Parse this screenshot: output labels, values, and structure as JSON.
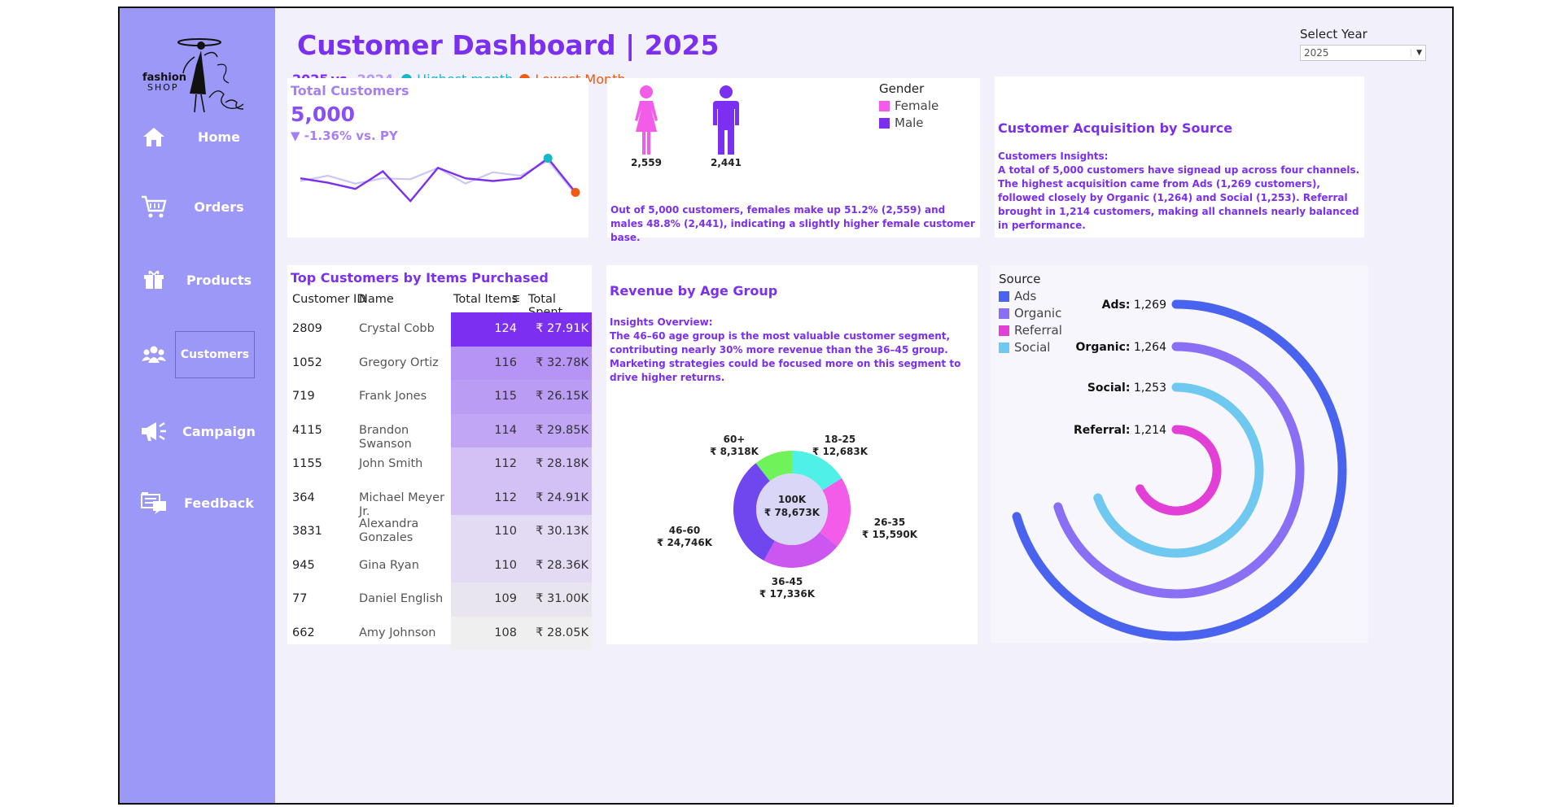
{
  "brand": {
    "line1": "fashion",
    "line2": "SHOP"
  },
  "sidebar": {
    "items": [
      {
        "label": "Home"
      },
      {
        "label": "Orders"
      },
      {
        "label": "Products"
      },
      {
        "label": "Customers"
      },
      {
        "label": "Campaign"
      },
      {
        "label": "Feedback"
      }
    ],
    "active": "Customers"
  },
  "header": {
    "title": "Customer Dashboard | 2025",
    "current_year": "2025",
    "vs": "vs.",
    "prior_year": "2024",
    "highest_label": "Highest month",
    "lowest_label": "Lowest Month"
  },
  "year_select": {
    "label": "Select Year",
    "value": "2025"
  },
  "kpi": {
    "label": "Total Customers",
    "value": "5,000",
    "change": "▼ -1.36% vs. PY",
    "trend_current": [
      36,
      31,
      24,
      44,
      10,
      48,
      36,
      33,
      36,
      59,
      20
    ],
    "trend_prior": [
      33,
      39,
      30,
      36,
      35,
      48,
      30,
      43,
      39,
      56,
      18
    ]
  },
  "gender": {
    "legend_title": "Gender",
    "female_label": "Female",
    "male_label": "Male",
    "female_count": "2,559",
    "male_count": "2,441",
    "insight": "Out of 5,000 customers, females make up 51.2% (2,559) and males 48.8% (2,441), indicating a slightly higher female customer base.",
    "colors": {
      "female": "#f25ce8",
      "male": "#7b2ff0"
    }
  },
  "acquisition": {
    "title": "Customer Acquisition by Source",
    "insight_heading": "Customers Insights:",
    "insight_body": "A total of 5,000 customers have signead up across four channels. The highest acquisition came from Ads (1,269 customers), followed closely by Organic (1,264) and Social (1,253). Referral brought in 1,214 customers, making all channels nearly balanced in performance."
  },
  "top_customers": {
    "title": "Top Customers by Items Purchased",
    "columns": [
      "Customer ID",
      "Name",
      "Total Items",
      "Total Spent"
    ],
    "rows": [
      {
        "id": "2809",
        "name": "Crystal Cobb",
        "items": "124",
        "spent": "₹ 27.91K",
        "shade": "#7b2ff0"
      },
      {
        "id": "1052",
        "name": "Gregory Ortiz",
        "items": "116",
        "spent": "₹ 32.78K",
        "shade": "#b694f5"
      },
      {
        "id": "719",
        "name": "Frank Jones",
        "items": "115",
        "spent": "₹ 26.15K",
        "shade": "#bb9cf5"
      },
      {
        "id": "4115",
        "name": "Brandon Swanson",
        "items": "114",
        "spent": "₹ 29.85K",
        "shade": "#c1a6f5"
      },
      {
        "id": "1155",
        "name": "John Smith",
        "items": "112",
        "spent": "₹ 28.18K",
        "shade": "#d3c1f5"
      },
      {
        "id": "364",
        "name": "Michael Meyer Jr.",
        "items": "112",
        "spent": "₹ 24.91K",
        "shade": "#d3c1f5"
      },
      {
        "id": "3831",
        "name": "Alexandra Gonzales",
        "items": "110",
        "spent": "₹ 30.13K",
        "shade": "#e3daf3"
      },
      {
        "id": "945",
        "name": "Gina Ryan",
        "items": "110",
        "spent": "₹ 28.36K",
        "shade": "#e3daf3"
      },
      {
        "id": "77",
        "name": "Daniel English",
        "items": "109",
        "spent": "₹ 31.00K",
        "shade": "#e9e5ef"
      },
      {
        "id": "662",
        "name": "Amy Johnson",
        "items": "108",
        "spent": "₹ 28.05K",
        "shade": "#efefef"
      }
    ]
  },
  "age": {
    "title": "Revenue by Age Group",
    "insight_heading": "Insights Overview:",
    "insight_body": "The 46–60 age group is the most valuable customer segment, contributing nearly 30% more revenue than the 36–45 group. Marketing strategies could be focused more on this segment to drive higher returns.",
    "center_top": "100K",
    "center_bottom": "₹ 78,673K"
  },
  "source": {
    "legend_title": "Source",
    "items": [
      "Ads",
      "Organic",
      "Referral",
      "Social"
    ],
    "legend_colors": [
      "#4a63ef",
      "#8a6ff5",
      "#e23fd6",
      "#6fc8ef"
    ]
  },
  "chart_data": [
    {
      "type": "pie",
      "title": "Revenue by Age Group",
      "categories": [
        "18-25",
        "26-35",
        "36-45",
        "46-60",
        "60+"
      ],
      "values": [
        12683,
        15590,
        17336,
        24746,
        8318
      ],
      "labels": [
        "₹ 12,683K",
        "₹ 15,590K",
        "₹ 17,336K",
        "₹ 24,746K",
        "₹ 8,318K"
      ],
      "colors": [
        "#4ff0e6",
        "#f25ce8",
        "#cc57f0",
        "#7046ee",
        "#6ff25a"
      ],
      "donut": true
    },
    {
      "type": "radial_bar",
      "title": "Customer Acquisition by Source",
      "categories": [
        "Ads",
        "Organic",
        "Social",
        "Referral"
      ],
      "values": [
        1269,
        1264,
        1253,
        1214
      ],
      "value_labels": [
        "1,269",
        "1,264",
        "1,253",
        "1,214"
      ],
      "colors": [
        "#4a63ef",
        "#8a6ff5",
        "#6fc8ef",
        "#e23fd6"
      ]
    }
  ]
}
